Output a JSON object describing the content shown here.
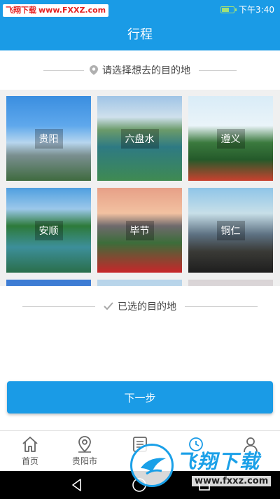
{
  "status_bar": {
    "watermark_name": "飞翔下载",
    "watermark_url": "www.FXXZ.com",
    "time": "下午3:40",
    "battery_level": 0.6
  },
  "header": {
    "title": "行程"
  },
  "destination_picker": {
    "prompt": "请选择想去的目的地",
    "icon": "map-pin-icon",
    "cities": [
      {
        "name": "贵阳"
      },
      {
        "name": "六盘水"
      },
      {
        "name": "遵义"
      },
      {
        "name": "安顺"
      },
      {
        "name": "毕节"
      },
      {
        "name": "铜仁"
      }
    ]
  },
  "selected_section": {
    "label": "已选的目的地",
    "icon": "check-icon"
  },
  "actions": {
    "next_label": "下一步"
  },
  "tab_bar": {
    "items": [
      {
        "label": "首页",
        "icon": "home-icon"
      },
      {
        "label": "贵阳市",
        "icon": "location-icon"
      },
      {
        "label": "",
        "icon": "list-icon"
      },
      {
        "label": "",
        "icon": "clock-icon"
      },
      {
        "label": "",
        "icon": "user-icon"
      }
    ]
  },
  "overlay_watermark": {
    "text": "飞翔下载",
    "url": "www.fxxz.com"
  },
  "colors": {
    "primary": "#1a9be6",
    "watermark_red": "#e62020"
  }
}
